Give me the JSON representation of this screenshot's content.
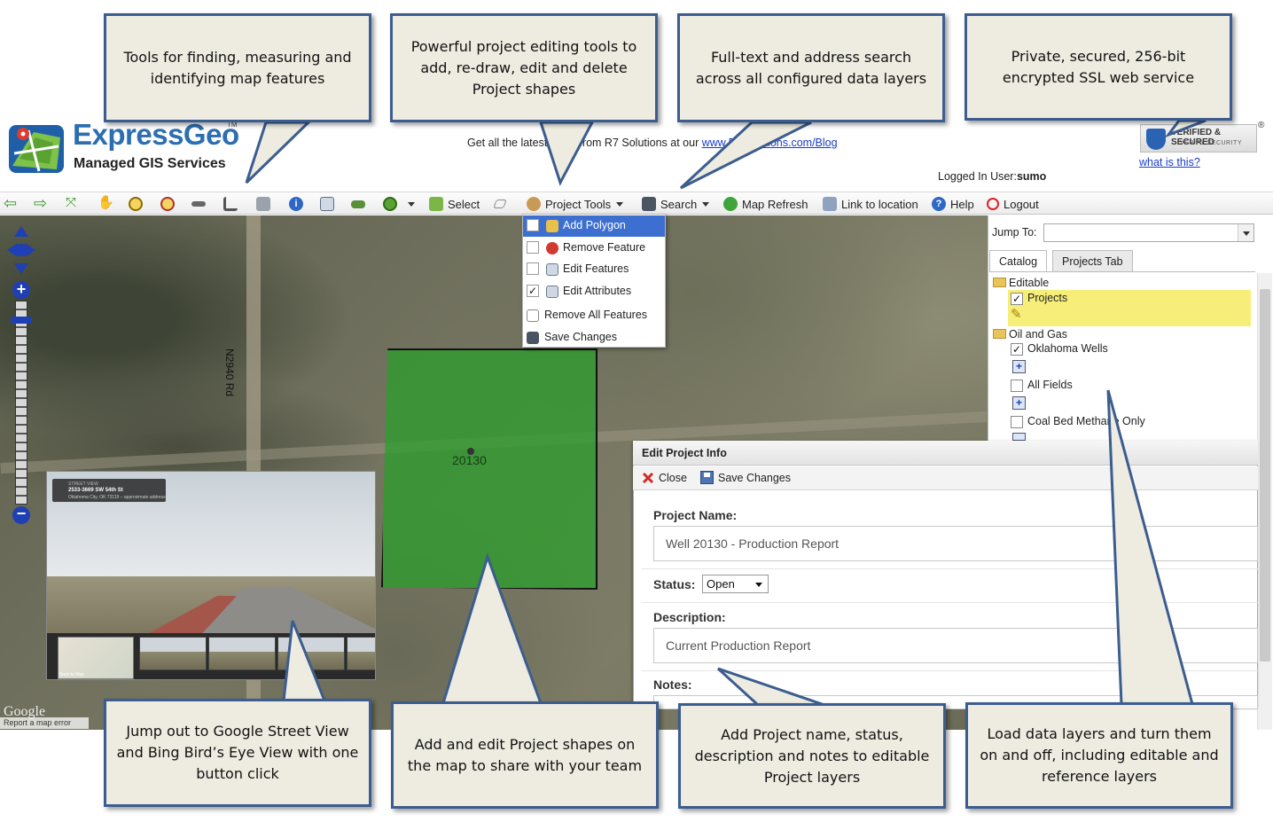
{
  "header": {
    "brand_name": "ExpressGeo",
    "brand_tm": "TM",
    "brand_sub": "Managed GIS Services",
    "blog_prefix": "Get all the latest news from R7 Solutions at our",
    "blog_link": "www.R7Solutions.com/Blog",
    "ssl_line1": "VERIFIED & SECURED",
    "ssl_line2": "VERIFY SECURITY",
    "ssl_reg": "®",
    "ssl_what": "what is this?",
    "logged_in_label": "Logged In User:",
    "logged_in_user": "sumo"
  },
  "toolbar": {
    "select_label": "Select",
    "project_tools_label": "Project Tools",
    "search_label": "Search",
    "map_refresh_label": "Map Refresh",
    "link_location_label": "Link to location",
    "help_label": "Help",
    "logout_label": "Logout"
  },
  "project_tools_menu": [
    {
      "label": "Add Polygon",
      "checked": false,
      "active": true
    },
    {
      "label": "Remove Feature",
      "checked": false
    },
    {
      "label": "Edit Features",
      "checked": false
    },
    {
      "label": "Edit Attributes",
      "checked": true
    },
    {
      "label": "Remove All Features"
    },
    {
      "label": "Save Changes"
    }
  ],
  "map": {
    "road_label": "N2940 Rd",
    "polygon_label": "20130",
    "google_label": "Google",
    "report_error": "Report a map error",
    "streetview": {
      "card_tag": "STREET VIEW",
      "card_title": "2533-3669 SW 54th St",
      "card_sub": "Oklahoma City, OK 73119 – approximate address",
      "back_to_map": "Back to Map"
    }
  },
  "right_panel": {
    "jump_to_label": "Jump To:",
    "tabs": [
      "Catalog",
      "Projects Tab"
    ],
    "tree": {
      "editable": "Editable",
      "projects": "Projects",
      "oil_gas": "Oil and Gas",
      "oklahoma_wells": "Oklahoma Wells",
      "all_fields": "All Fields",
      "coal_bed": "Coal Bed Methane Only"
    }
  },
  "edit_panel": {
    "title": "Edit Project Info",
    "close_label": "Close",
    "save_label": "Save Changes",
    "project_name_label": "Project Name:",
    "project_name_value": "Well 20130 - Production Report",
    "status_label": "Status:",
    "status_value": "Open",
    "description_label": "Description:",
    "description_value": "Current Production Report",
    "notes_label": "Notes:"
  },
  "callouts": {
    "tools": "Tools for finding, measuring and identifying map features",
    "editing": "Powerful project editing tools to add, re-draw, edit and delete Project shapes",
    "search": "Full-text and address search across all configured data layers",
    "ssl": "Private, secured, 256-bit encrypted SSL web service",
    "streetview": "Jump out to Google Street View and Bing Bird’s Eye View with one button click",
    "shapes": "Add and edit Project shapes on the map to share with your team",
    "projinfo": "Add Project name, status, description and notes to editable Project layers",
    "layers": "Load data layers and turn them on and off, including editable and reference layers"
  },
  "colors": {
    "callout_bg": "#eeece1",
    "callout_border": "#3b5d8f",
    "polygon_fill": "#28a028",
    "menu_active": "#3d6fd1",
    "link": "#1a3cc8"
  }
}
